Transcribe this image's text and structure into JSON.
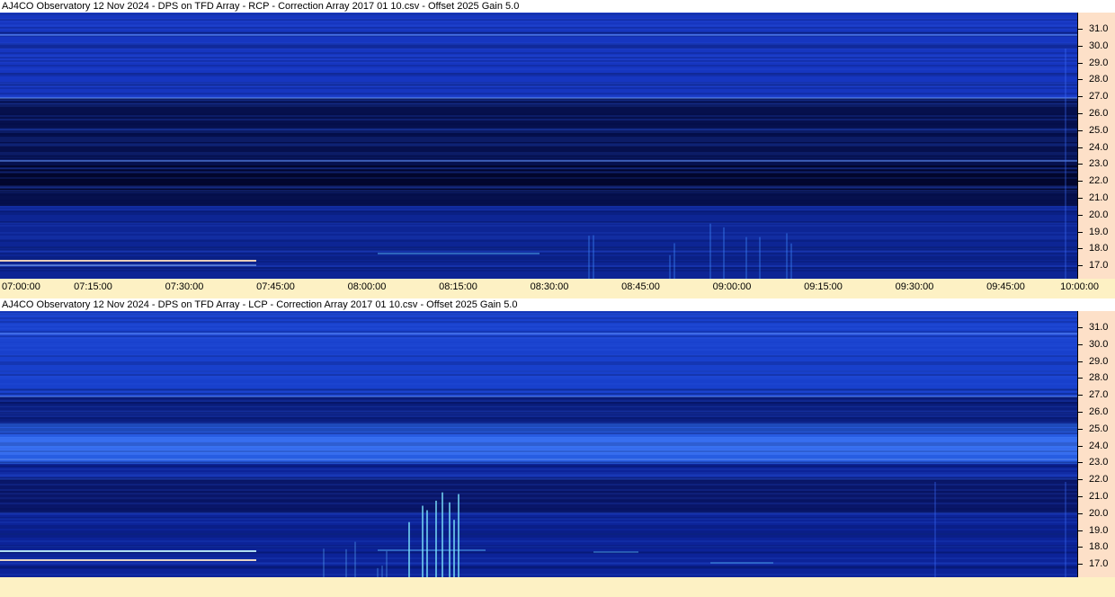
{
  "panels": [
    {
      "id": "rcp",
      "title": "AJ4CO Observatory 12 Nov 2024  -  DPS on TFD Array  -  RCP  -  Correction Array 2017 01 10.csv  -  Offset 2025  Gain 5.0",
      "freq_ticks": [
        "31.0",
        "30.0",
        "29.0",
        "28.0",
        "27.0",
        "26.0",
        "25.0",
        "24.0",
        "23.0",
        "22.0",
        "21.0",
        "20.0",
        "19.0",
        "18.0",
        "17.0"
      ],
      "show_time_labels": true
    },
    {
      "id": "lcp",
      "title": "AJ4CO Observatory 12 Nov 2024  -  DPS on TFD Array  -  LCP  -  Correction Array 2017 01 10.csv  -  Offset 2025  Gain 5.0",
      "freq_ticks": [
        "31.0",
        "30.0",
        "29.0",
        "28.0",
        "27.0",
        "26.0",
        "25.0",
        "24.0",
        "23.0",
        "22.0",
        "21.0",
        "20.0",
        "19.0",
        "18.0",
        "17.0"
      ],
      "show_time_labels": false
    }
  ],
  "time_labels": [
    "07:00:00",
    "07:15:00",
    "07:30:00",
    "07:45:00",
    "08:00:00",
    "08:15:00",
    "08:30:00",
    "08:45:00",
    "09:00:00",
    "09:15:00",
    "09:30:00",
    "09:45:00",
    "10:00:00"
  ],
  "colors": {
    "background_dark": "#050a3a",
    "background_mid": "#1233b8",
    "background_bright": "#2f6cf0",
    "burst": "#7fe8ff",
    "axis_bg": "#fde0c8",
    "time_axis_bg": "#fdf1c4"
  }
}
